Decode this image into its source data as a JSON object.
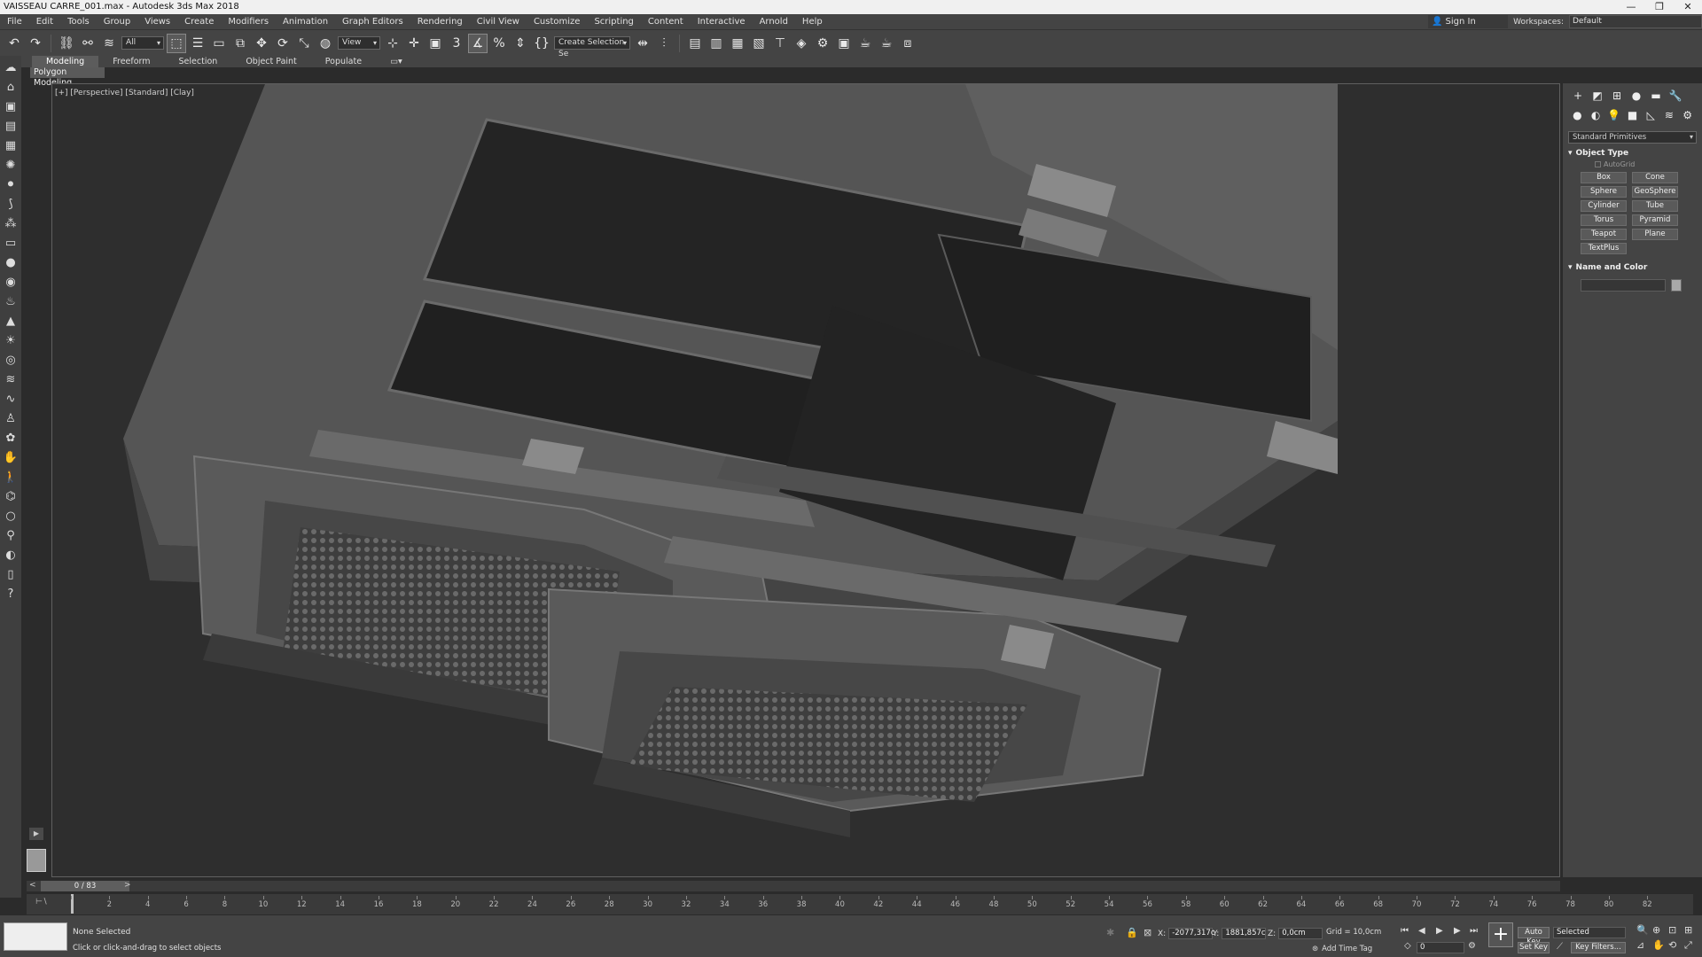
{
  "window": {
    "title": "VAISSEAU CARRE_001.max - Autodesk 3ds Max 2018",
    "minimize": "—",
    "restore": "❐",
    "close": "✕"
  },
  "menu": [
    "File",
    "Edit",
    "Tools",
    "Group",
    "Views",
    "Create",
    "Modifiers",
    "Animation",
    "Graph Editors",
    "Rendering",
    "Civil View",
    "Customize",
    "Scripting",
    "Content",
    "Interactive",
    "Arnold",
    "Help"
  ],
  "account": {
    "sign_in": "Sign In",
    "workspaces_label": "Workspaces:",
    "workspace": "Default"
  },
  "toolbar": {
    "selection_filter": "All",
    "ref_coord": "View",
    "named_selection": "Create Selection Se"
  },
  "ribbon": {
    "tabs": [
      "Modeling",
      "Freeform",
      "Selection",
      "Object Paint",
      "Populate"
    ],
    "active": "Modeling",
    "subtab": "Polygon Modeling"
  },
  "viewport": {
    "label": "[+] [Perspective] [Standard] [Clay]"
  },
  "command_panel": {
    "category": "Standard Primitives",
    "object_type_title": "Object Type",
    "autogrid": "AutoGrid",
    "primitives": [
      "Box",
      "Cone",
      "Sphere",
      "GeoSphere",
      "Cylinder",
      "Tube",
      "Torus",
      "Pyramid",
      "Teapot",
      "Plane",
      "TextPlus"
    ],
    "name_color_title": "Name and Color"
  },
  "time": {
    "slider_label": "0 / 83",
    "ticks": [
      0,
      2,
      4,
      6,
      8,
      10,
      12,
      14,
      16,
      18,
      20,
      22,
      24,
      26,
      28,
      30,
      32,
      34,
      36,
      38,
      40,
      42,
      44,
      46,
      48,
      50,
      52,
      54,
      56,
      58,
      60,
      62,
      64,
      66,
      68,
      70,
      72,
      74,
      76,
      78,
      80,
      82
    ]
  },
  "status": {
    "selection": "None Selected",
    "prompt": "Click or click-and-drag to select objects",
    "x_label": "X:",
    "x": "-2077,317c",
    "y_label": "Y:",
    "y": "1881,857c",
    "z_label": "Z:",
    "z": "0,0cm",
    "grid": "Grid = 10,0cm",
    "add_time_tag": "Add Time Tag",
    "auto_key": "Auto Key",
    "set_key": "Set Key",
    "key_mode": "Selected",
    "key_filters": "Key Filters...",
    "frame": "0"
  }
}
